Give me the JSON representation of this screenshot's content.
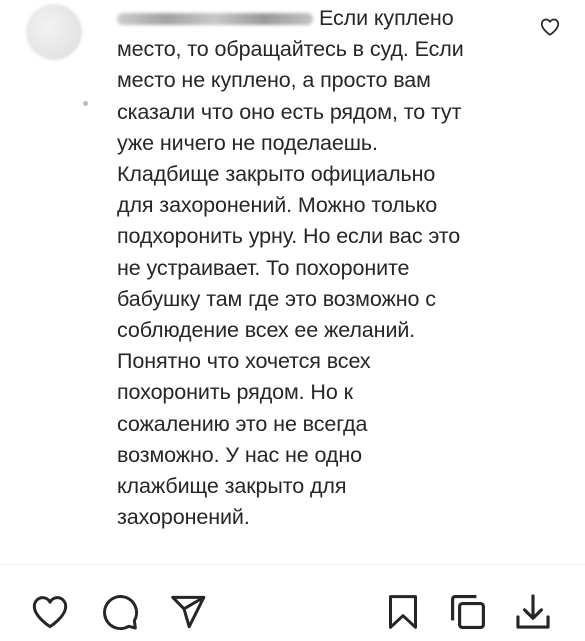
{
  "comment": {
    "username_hidden": true,
    "lines": [
      "Если куплено",
      "место, то обращайтесь в суд. Если",
      "место не куплено, а просто вам",
      "сказали что оно есть рядом, то тут",
      "уже ничего не поделаешь.",
      "Кладбище закрыто официально",
      "для захоронений. Можно только",
      "подхоронить урну. Но если вас это",
      "не устраивает. То похороните",
      "бабушку там где это возможно с",
      "соблюдение всех ее желаний.",
      "Понятно что хочется всех",
      "похоронить рядом. Но к",
      "сожалению это не всегда",
      "возможно. У нас не одно",
      "клажбище закрыто для",
      "захоронений."
    ]
  },
  "icons": {
    "comment_like": "heart-outline-icon",
    "like": "heart-outline-icon",
    "comment": "speech-bubble-icon",
    "share": "paper-plane-icon",
    "save": "bookmark-icon",
    "copy": "copy-icon",
    "download": "download-icon"
  },
  "colors": {
    "text": "#262626",
    "icon": "#262626",
    "divider": "#efefef",
    "background": "#ffffff"
  }
}
